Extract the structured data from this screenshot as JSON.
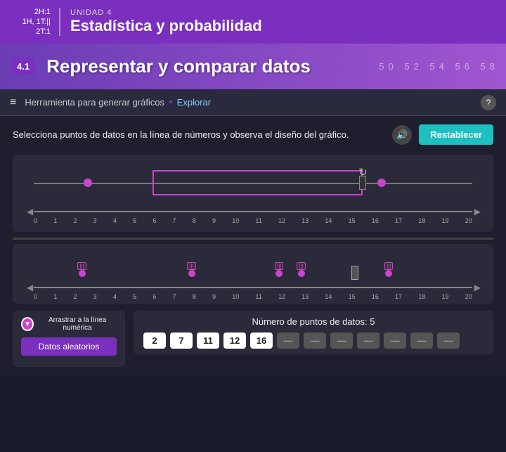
{
  "header": {
    "time_line1": "2H:1",
    "time_line2": "1H, 1T:||",
    "time_line3": "2T:1",
    "unit_label": "UNIDAD 4",
    "title": "Estadística y probabilidad"
  },
  "section": {
    "badge": "4.1",
    "title": "Representar y comparar datos",
    "numbers": "50 52 54 56 58"
  },
  "toolbar": {
    "menu_label": "≡",
    "tool_label": "Herramienta para generar gráficos",
    "separator": "•",
    "explore_label": "Explorar",
    "help_label": "?"
  },
  "instruction": {
    "text": "Selecciona puntos de datos en la línea de números y observa el diseño del gráfico.",
    "speaker_icon": "🔊",
    "reset_label": "Restablecer"
  },
  "number_line": {
    "ticks": [
      "0",
      "1",
      "2",
      "3",
      "4",
      "5",
      "6",
      "7",
      "8",
      "9",
      "10",
      "11",
      "12",
      "13",
      "14",
      "15",
      "16",
      "17",
      "18",
      "19",
      "20"
    ]
  },
  "dot_line": {
    "ticks": [
      "0",
      "1",
      "2",
      "3",
      "4",
      "5",
      "6",
      "7",
      "8",
      "9",
      "10",
      "11",
      "12",
      "13",
      "14",
      "15",
      "16",
      "17",
      "18",
      "19",
      "20"
    ]
  },
  "bottom": {
    "drag_label": "Arrastrar a la línea numérica",
    "random_label": "Datos aleatorios",
    "data_count_label": "Número de puntos de datos: 5",
    "values": [
      "2",
      "7",
      "11",
      "12",
      "16",
      "—",
      "—",
      "—",
      "—",
      "—",
      "—",
      "—"
    ]
  }
}
